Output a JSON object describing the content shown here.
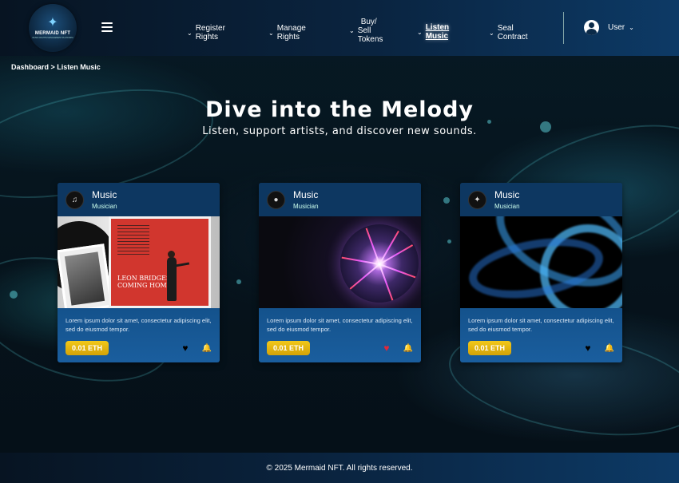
{
  "app": {
    "logo_text": "MERMAID NFT",
    "logo_subtext": "MUSIC RIGHTS MANAGEMENT PLATFORM"
  },
  "nav": {
    "items": [
      {
        "label": "Register Rights",
        "active": false
      },
      {
        "label": "Manage Rights",
        "active": false
      },
      {
        "label_line1": "Buy/",
        "label_line2": "Sell Tokens",
        "active": false
      },
      {
        "label": "Listen Music",
        "active": true
      },
      {
        "label": "Seal Contract",
        "active": false
      }
    ],
    "user_label": "User"
  },
  "breadcrumb": "Dashboard > Listen Music",
  "hero": {
    "title": "Dive into the Melody",
    "subtitle": "Listen, support artists, and discover new sounds."
  },
  "cards": [
    {
      "title": "Music",
      "artist": "Musician",
      "description": "Lorem ipsum dolor sit amet, consectetur adipiscing elit, sed do eiusmod tempor.",
      "price": "0.01 ETH",
      "liked": false,
      "image_icon": "album-cover-image"
    },
    {
      "title": "Music",
      "artist": "Musician",
      "description": "Lorem ipsum dolor sit amet, consectetur adipiscing elit, sed do eiusmod tempor.",
      "price": "0.01 ETH",
      "liked": true,
      "image_icon": "plasma-ball-image"
    },
    {
      "title": "Music",
      "artist": "Musician",
      "description": "Lorem ipsum dolor sit amet, consectetur adipiscing elit, sed do eiusmod tempor.",
      "price": "0.01 ETH",
      "liked": false,
      "image_icon": "blue-wave-image"
    }
  ],
  "album_cover": {
    "line1": "LEON BRIDGES",
    "line2": "COMING HOME"
  },
  "footer": "© 2025 Mermaid NFT. All rights reserved.",
  "colors": {
    "accent": "#f2c81a",
    "card": "#14528c",
    "header": "#0a2440",
    "liked": "#e0283a"
  }
}
